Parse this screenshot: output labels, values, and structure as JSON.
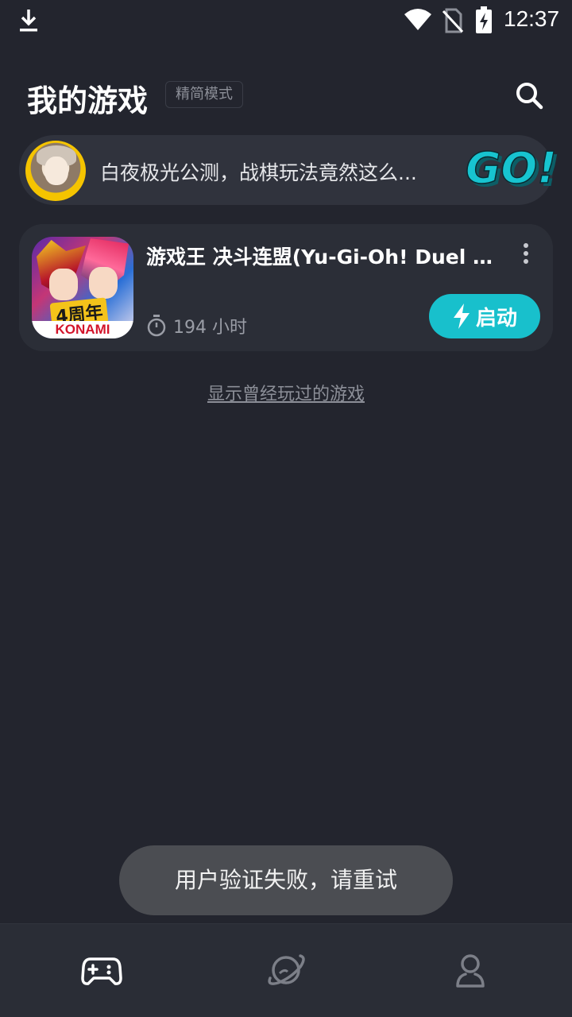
{
  "status_bar": {
    "time": "12:37",
    "icons": [
      "download-icon",
      "wifi-icon",
      "no-sim-icon",
      "battery-charging-icon"
    ]
  },
  "header": {
    "title": "我的游戏",
    "mode_badge": "精简模式",
    "search_icon": "search-icon"
  },
  "banner": {
    "text": "白夜极光公测，战棋玩法竟然这么...",
    "go_label": "GO!"
  },
  "game": {
    "name": "游戏王 决斗连盟(Yu-Gi-Oh! Duel L...",
    "icon_anniversary": "4周年",
    "icon_brand": "KONAMI",
    "playtime": "194 小时",
    "launch_label": "启动"
  },
  "history_link": "显示曾经玩过的游戏",
  "toast": "用户验证失败，请重试",
  "bottom_nav": {
    "items": [
      "gamepad-icon",
      "planet-icon",
      "profile-icon"
    ],
    "active": "gamepad-icon"
  },
  "colors": {
    "background": "#23252e",
    "card": "#2b2e37",
    "accent": "#18c0cc",
    "toast": "#4b4d52"
  }
}
